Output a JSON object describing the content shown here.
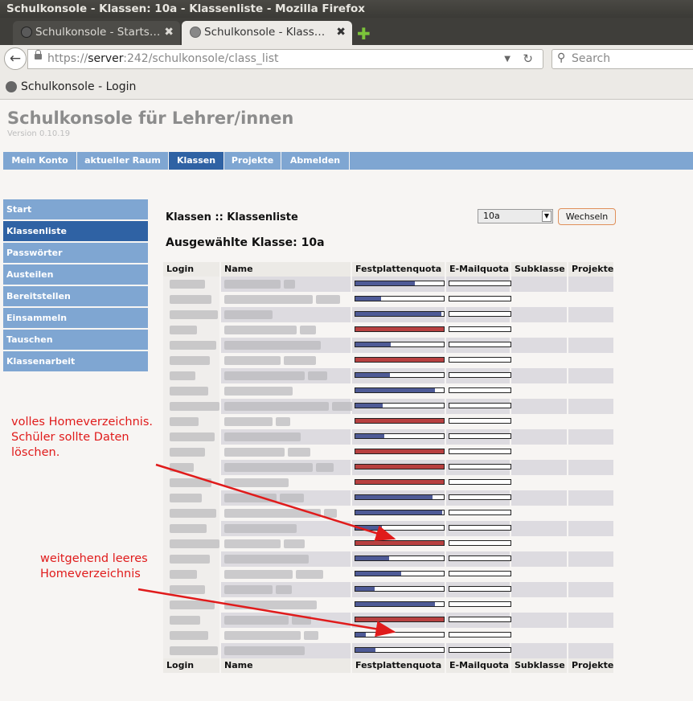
{
  "window": {
    "title": "Schulkonsole - Klassen: 10a - Klassenliste - Mozilla Firefox"
  },
  "tabs": [
    {
      "label": "Schulkonsole - Starts…",
      "close": "✖"
    },
    {
      "label": "Schulkonsole - Klass…",
      "close": "✖"
    }
  ],
  "newtab": "✚",
  "url": {
    "prefix": "https://",
    "host": "server",
    "rest": ":242/schulkonsole/class_list"
  },
  "search": {
    "placeholder": "Search"
  },
  "bookmark": {
    "label": "Schulkonsole - Login"
  },
  "app": {
    "title": "Schulkonsole für Lehrer/innen",
    "version": "Version 0.10.19"
  },
  "menu": [
    "Mein Konto",
    "aktueller Raum",
    "Klassen",
    "Projekte",
    "Abmelden"
  ],
  "sidebar": [
    "Start",
    "Klassenliste",
    "Passwörter",
    "Austeilen",
    "Bereitstellen",
    "Einsammeln",
    "Tauschen",
    "Klassenarbeit"
  ],
  "page": {
    "heading": "Klassen :: Klassenliste",
    "selected": "Ausgewählte Klasse: 10a"
  },
  "class_select": {
    "value": "10a",
    "button": "Wechseln"
  },
  "table": {
    "columns": [
      "Login",
      "Name",
      "Festplattenquota",
      "E-Mailquota",
      "Subklasse",
      "Projekte"
    ],
    "quota_usage": [
      0.67,
      0.29,
      0.97,
      1.0,
      0.4,
      1.0,
      0.39,
      0.9,
      0.31,
      1.0,
      0.33,
      1.0,
      1.0,
      1.0,
      0.87,
      0.98,
      0.3,
      1.0,
      0.38,
      0.52,
      0.22,
      0.9,
      1.0,
      0.12,
      0.23
    ],
    "quota_colors": {
      "normal": "#4e5a96",
      "full": "#b84040"
    }
  },
  "annotations": [
    {
      "text": "volles Homeverzeichnis.\nSchüler sollte Daten\nlöschen."
    },
    {
      "text": "weitgehend leeres\nHomeverzeichnis"
    }
  ]
}
